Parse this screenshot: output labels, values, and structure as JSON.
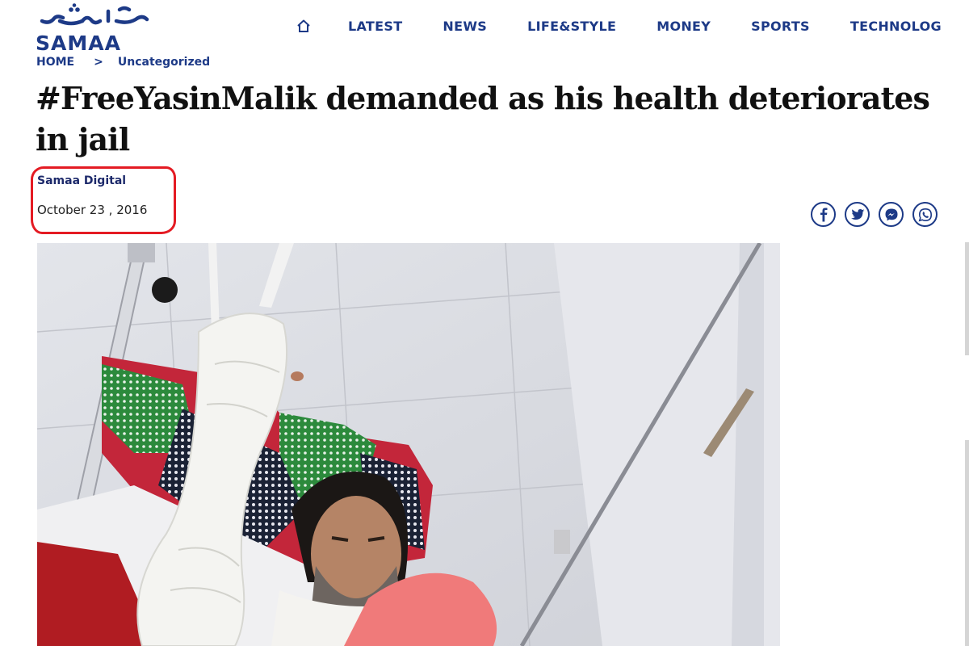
{
  "brand": {
    "name": "SAMAA",
    "accent_color": "#1d3a87"
  },
  "nav": {
    "home_icon": "home-icon",
    "items": [
      "LATEST",
      "NEWS",
      "LIFE&STYLE",
      "MONEY",
      "SPORTS",
      "TECHNOLOG"
    ]
  },
  "breadcrumb": {
    "home": "HOME",
    "separator": ">",
    "category": "Uncategorized"
  },
  "article": {
    "headline_line1": "#FreeYasinMalik demanded as his health deteriorates",
    "headline_line2": "in jail",
    "author": "Samaa Digital",
    "date": "October 23 , 2016",
    "highlight_color": "#e41b23"
  },
  "share": {
    "icons": [
      "facebook-icon",
      "twitter-icon",
      "messenger-icon",
      "whatsapp-icon"
    ]
  }
}
